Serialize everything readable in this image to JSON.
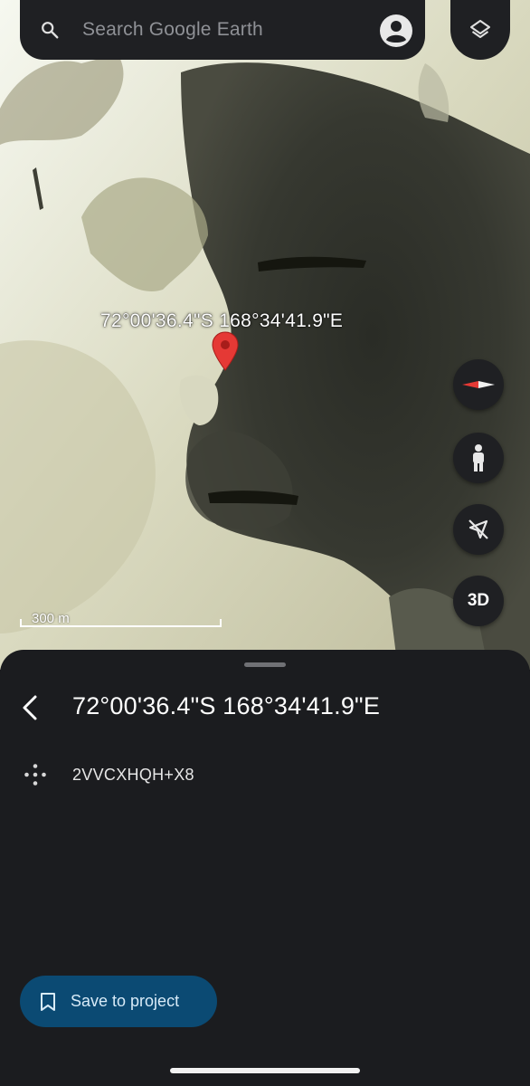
{
  "search": {
    "placeholder": "Search Google Earth",
    "icon": "search-icon"
  },
  "header": {
    "account_icon": "account-circle-icon",
    "layers_icon": "layers-icon"
  },
  "map": {
    "pin_label": "72°00'36.4\"S 168°34'41.9\"E",
    "pin_color": "#e53935",
    "scale_label": "300 m",
    "controls": {
      "compass_icon": "compass-icon",
      "street_view_icon": "pegman-icon",
      "location_icon": "location-off-icon",
      "view_3d_label": "3D"
    }
  },
  "sheet": {
    "title": "72°00'36.4\"S 168°34'41.9\"E",
    "plus_code": "2VVCXHQH+X8",
    "plus_code_icon": "plus-code-icon",
    "save_button_label": "Save to project",
    "save_button_icon": "bookmark-icon",
    "save_button_color": "#0b4a73"
  }
}
